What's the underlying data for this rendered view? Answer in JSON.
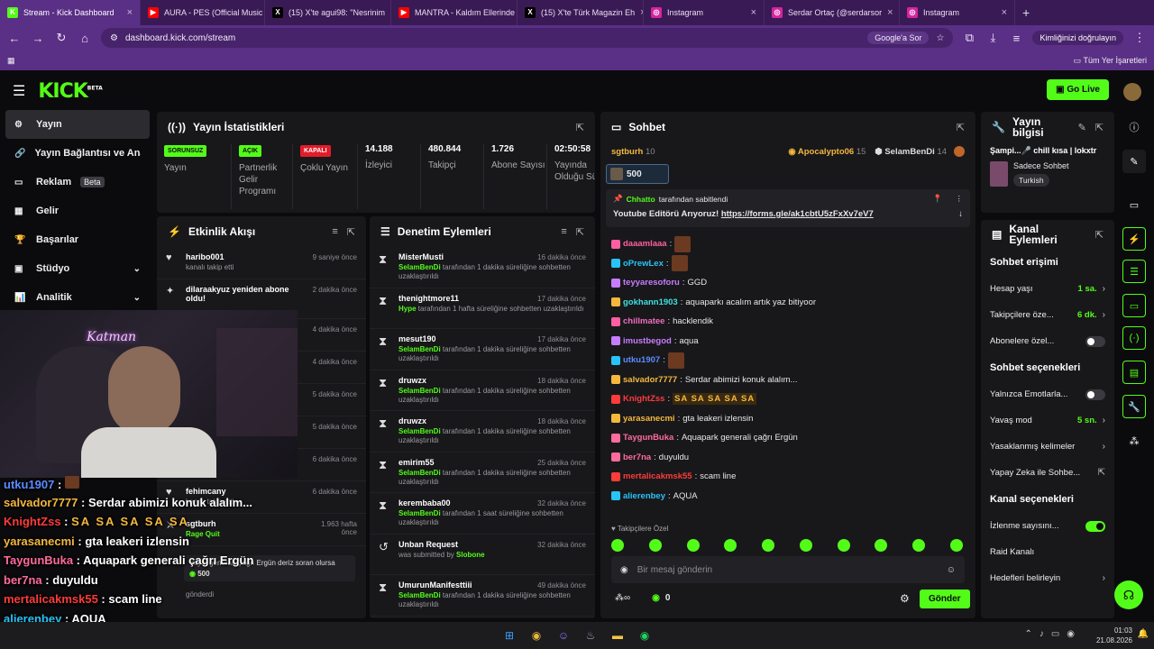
{
  "browser": {
    "tabs": [
      {
        "title": "Stream - Kick Dashboard",
        "fav": "K",
        "color": "#53fc18",
        "active": true
      },
      {
        "title": "AURA - PES (Official Music",
        "fav": "▶",
        "color": "#ff0000"
      },
      {
        "title": "(15) X'te agui98: \"Nesrinim",
        "fav": "X",
        "color": "#000000"
      },
      {
        "title": "MANTRA - Kaldım Ellerinde",
        "fav": "▶",
        "color": "#ff0000"
      },
      {
        "title": "(15) X'te Türk Magazin Eh",
        "fav": "X",
        "color": "#000000"
      },
      {
        "title": "Instagram",
        "fav": "◎",
        "color": "#d6249f"
      },
      {
        "title": "Serdar Ortaç (@serdarsor",
        "fav": "◎",
        "color": "#d6249f"
      },
      {
        "title": "Instagram",
        "fav": "◎",
        "color": "#d6249f"
      }
    ],
    "url": "dashboard.kick.com/stream",
    "google_btn": "Google'a Sor",
    "verify_text": "Kimliğinizi doğrulayın",
    "bookmarks_label": "Tüm Yer İşaretleri"
  },
  "header": {
    "logo": "KICK",
    "logo_sup": "BETA",
    "go_live": "Go Live"
  },
  "sidebar": {
    "items": [
      {
        "label": "Yayın",
        "icon": "⚙",
        "active": true
      },
      {
        "label": "Yayın Bağlantısı ve Anahtarı",
        "icon": "🔗"
      },
      {
        "label": "Reklam",
        "icon": "▭",
        "badge": "Beta"
      },
      {
        "label": "Gelir",
        "icon": "▦"
      },
      {
        "label": "Başarılar",
        "icon": "🏆"
      },
      {
        "label": "Stüdyo",
        "icon": "▣",
        "chev": true
      },
      {
        "label": "Analitik",
        "icon": "📊",
        "chev": true
      }
    ]
  },
  "stats": {
    "title": "Yayın İstatistikleri",
    "items": [
      {
        "tag": "SORUNSUZ",
        "tag_color": "#53fc18",
        "label": "Yayın"
      },
      {
        "tag": "AÇIK",
        "tag_color": "#53fc18",
        "label": "Partnerlik Gelir Programı"
      },
      {
        "tag": "KAPALI",
        "tag_color": "#e11d2a",
        "label": "Çoklu Yayın"
      },
      {
        "value": "14.188",
        "label": "İzleyici"
      },
      {
        "value": "480.844",
        "label": "Takipçi"
      },
      {
        "value": "1.726",
        "label": "Abone Sayısı"
      },
      {
        "value": "02:50:58",
        "label": "Yayında Olduğu Süre"
      }
    ]
  },
  "activity": {
    "title": "Etkinlik Akışı",
    "items": [
      {
        "name": "haribo001",
        "sub": "kanalı takip etti",
        "time": "9 saniye önce",
        "icon": "♥"
      },
      {
        "name": "dilaraakyuz yeniden abone oldu!",
        "sub": "",
        "time": "2 dakika önce",
        "icon": "✦"
      },
      {
        "name": "",
        "sub": "",
        "time": "4 dakika önce",
        "icon": ""
      },
      {
        "name": "",
        "sub": "",
        "time": "4 dakika önce",
        "icon": ""
      },
      {
        "name": "",
        "sub": "",
        "time": "5 dakika önce",
        "icon": ""
      },
      {
        "name": "",
        "sub": "lik hediye etti.",
        "time": "5 dakika önce",
        "icon": ""
      },
      {
        "name": "",
        "sub": "",
        "time": "6 dakika önce",
        "icon": ""
      },
      {
        "name": "fehimcany",
        "sub": "kanalı takip etti",
        "time": "6 dakika önce",
        "icon": "♥"
      },
      {
        "name": "sgtburh",
        "sub": "Rage Quit",
        "time": "1.963 hafta önce",
        "icon": "⚔"
      }
    ],
    "redeem_text": "Yayın generali Çağrı Ergün deriz soran olursa",
    "redeem_cost": "500",
    "redeem_sub": "gönderdi"
  },
  "moderation": {
    "title": "Denetim Eylemleri",
    "items": [
      {
        "name": "MisterMusti",
        "by": "SelamBenDi",
        "text": "tarafından 1 dakika süreliğine sohbetten uzaklaştırıldı",
        "time": "16 dakika önce",
        "icon": "⧗"
      },
      {
        "name": "thenightmore11",
        "by": "Hype",
        "text": "tarafından 1 hafta süreliğine sohbetten uzaklaştırıldı",
        "time": "17 dakika önce",
        "icon": "⧗"
      },
      {
        "name": "mesut190",
        "by": "SelamBenDi",
        "text": "tarafından 1 dakika süreliğine sohbetten uzaklaştırıldı",
        "time": "17 dakika önce",
        "icon": "⧗"
      },
      {
        "name": "druwzx",
        "by": "SelamBenDi",
        "text": "tarafından 1 dakika süreliğine sohbetten uzaklaştırıldı",
        "time": "18 dakika önce",
        "icon": "⧗"
      },
      {
        "name": "druwzx",
        "by": "SelamBenDi",
        "text": "tarafından 1 dakika süreliğine sohbetten uzaklaştırıldı",
        "time": "18 dakika önce",
        "icon": "⧗"
      },
      {
        "name": "emirim55",
        "by": "SelamBenDi",
        "text": "tarafından 1 dakika süreliğine sohbetten uzaklaştırıldı",
        "time": "25 dakika önce",
        "icon": "⧗"
      },
      {
        "name": "kerembaba00",
        "by": "SelamBenDi",
        "text": "tarafından 1 saat süreliğine sohbetten uzaklaştırıldı",
        "time": "32 dakika önce",
        "icon": "⧗"
      },
      {
        "name": "Unban Request",
        "by": "Slobone",
        "text": "was submitted by",
        "time": "32 dakika önce",
        "icon": "↺",
        "prefix": true
      },
      {
        "name": "UmurunManifesttiii",
        "by": "SelamBenDi",
        "text": "tarafından 1 dakika süreliğine sohbetten uzaklaştırıldı",
        "time": "49 dakika önce",
        "icon": "⧗"
      }
    ]
  },
  "chat": {
    "title": "Sohbet",
    "top": [
      {
        "name": "sgtburh",
        "count": "10"
      },
      {
        "name": "Apocalypto06",
        "count": "15"
      },
      {
        "name": "SelamBenDi",
        "count": "14"
      }
    ],
    "gift_count": "500",
    "pinned_by": "Chhatto",
    "pinned_suffix": "tarafından sabitlendi",
    "pinned_text": "Youtube Editörü Arıyoruz!",
    "pinned_link": "https://forms.gle/ak1cbtU5zFxXv7eV7",
    "messages": [
      {
        "user": "daaamlaaa",
        "color": "#ff5fa2",
        "text": ""
      },
      {
        "user": "oPrewLex",
        "color": "#29c4f6",
        "text": ""
      },
      {
        "user": "teyyaresoforu",
        "color": "#c77dff",
        "text": "GGD"
      },
      {
        "user": "gokhann1903",
        "color": "#3ee0e0",
        "text": "aquaparkı acalım artık yaz bitiyoor"
      },
      {
        "user": "chillmatee",
        "color": "#f06dc0",
        "text": "hacklendik"
      },
      {
        "user": "imustbegod",
        "color": "#c77dff",
        "text": "aqua"
      },
      {
        "user": "utku1907",
        "color": "#5b8cff",
        "text": ""
      },
      {
        "user": "salvador7777",
        "color": "#f5b83d",
        "text": "Serdar abimizi konuk alalım..."
      },
      {
        "user": "KnightZss",
        "color": "#ff3b3b",
        "text": "SA SA SA SA SA"
      },
      {
        "user": "yarasanecmi",
        "color": "#f5b83d",
        "text": "gta leakeri izlensin"
      },
      {
        "user": "TaygunBuka",
        "color": "#ff6b9a",
        "text": "Aquapark generali çağrı Ergün"
      },
      {
        "user": "ber7na",
        "color": "#ff6b9a",
        "text": "duyuldu"
      },
      {
        "user": "mertalicakmsk55",
        "color": "#ff3b3b",
        "text": "scam line"
      },
      {
        "user": "alierenbey",
        "color": "#29c4f6",
        "text": "AQUA"
      }
    ],
    "followers_only": "Takipçilere Özel",
    "input_placeholder": "Bir mesaj gönderin",
    "viewers": "0",
    "send_label": "Gönder"
  },
  "stream_info": {
    "title": "Yayın bilgisi",
    "stream_title": "Şampi...🎤 chill kısa | lokxtr",
    "category": "Sadece Sohbet",
    "language": "Turkish"
  },
  "channel_actions": {
    "title": "Kanal Eylemleri",
    "chat_access": "Sohbet erişimi",
    "account_age": "Hesap yaşı",
    "account_age_val": "1 sa.",
    "followers_only": "Takipçilere öze...",
    "followers_only_val": "6 dk.",
    "subs_only": "Abonelere özel...",
    "chat_options": "Sohbet seçenekleri",
    "emotes_only": "Yalnızca Emotlarla...",
    "slow_mode": "Yavaş mod",
    "slow_mode_val": "5 sn.",
    "banned_words": "Yasaklanmış kelimeler",
    "ai_chat": "Yapay Zeka ile Sohbe...",
    "channel_options": "Kanal seçenekleri",
    "viewer_count": "İzlenme sayısını...",
    "raid": "Raid Kanalı",
    "goals": "Hedefleri belirleyin"
  },
  "webcam_label": "Katman",
  "overlay_chat": [
    {
      "user": "utku1907",
      "color": "#5b8cff",
      "text": ""
    },
    {
      "user": "salvador7777",
      "color": "#f5b83d",
      "text": "Serdar abimizi konuk alalım..."
    },
    {
      "user": "KnightZss",
      "color": "#ff3b3b",
      "text": "SA SA SA SA SA"
    },
    {
      "user": "yarasanecmi",
      "color": "#f5b83d",
      "text": "gta leakeri izlensin"
    },
    {
      "user": "TaygunBuka",
      "color": "#ff6b9a",
      "text": "Aquapark generali çağrı Ergün"
    },
    {
      "user": "ber7na",
      "color": "#ff6b9a",
      "text": "duyuldu"
    },
    {
      "user": "mertalicakmsk55",
      "color": "#ff3b3b",
      "text": "scam line"
    },
    {
      "user": "alierenbey",
      "color": "#29c4f6",
      "text": "AQUA"
    }
  ],
  "taskbar": {
    "time": "01:03",
    "date": "21.08.2026"
  }
}
